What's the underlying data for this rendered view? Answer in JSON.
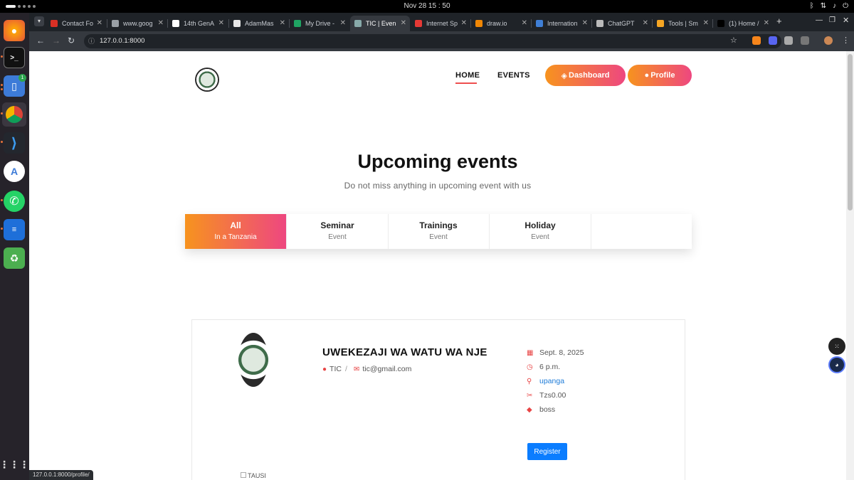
{
  "system": {
    "clock": "Nov 28  15 : 50",
    "dock_badge": "1"
  },
  "browser": {
    "tabs": [
      {
        "label": "Contact Fo",
        "color": "#d93025"
      },
      {
        "label": "www.goog",
        "color": "#9aa0a6"
      },
      {
        "label": "14th GenA",
        "color": "#ffffff"
      },
      {
        "label": "AdamMas",
        "color": "#e6e6e6"
      },
      {
        "label": "My Drive -",
        "color": "#1fa463"
      },
      {
        "label": "TIC | Even",
        "color": "#8aa"
      },
      {
        "label": "Internet Sp",
        "color": "#e53935"
      },
      {
        "label": "draw.io",
        "color": "#f08705"
      },
      {
        "label": "Internation",
        "color": "#3f7fd6"
      },
      {
        "label": "ChatGPT",
        "color": "#bbbbbb"
      },
      {
        "label": "Tools | Sm",
        "color": "#f6a623"
      },
      {
        "label": "(1) Home /",
        "color": "#000000"
      }
    ],
    "url": "127.0.0.1:8000",
    "status_url": "127.0.0.1:8000/profile/"
  },
  "site": {
    "nav": {
      "home": "HOME",
      "events": "EVENTS",
      "dashboard": "Dashboard",
      "profile": "Profile"
    },
    "heading": "Upcoming events",
    "subheading": "Do not miss anything in upcoming event with us",
    "event_tabs": [
      {
        "title": "All",
        "sub": "In a Tanzania"
      },
      {
        "title": "Seminar",
        "sub": "Event"
      },
      {
        "title": "Trainings",
        "sub": "Event"
      },
      {
        "title": "Holiday",
        "sub": "Event"
      }
    ],
    "event": {
      "title": "UWEKEZAJI WA WATU WA NJE",
      "organizer": "TIC",
      "separator": "/",
      "email": "tic@gmail.com",
      "date": "Sept. 8, 2025",
      "time": "6 p.m.",
      "location": "upanga",
      "price": "Tzs0.00",
      "tag": "boss",
      "register": "Register",
      "image_alt": "TAUSI"
    }
  }
}
